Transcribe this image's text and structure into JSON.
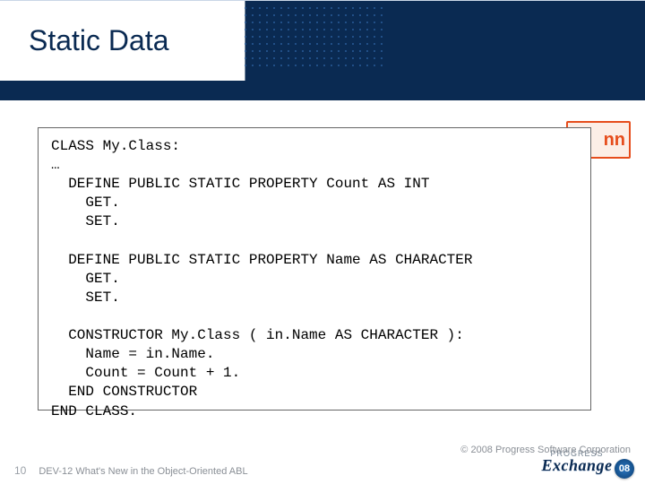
{
  "title": "Static Data",
  "peek_label": "nn",
  "code": {
    "line1": "CLASS My.Class:",
    "line2": "…",
    "line3": "  DEFINE PUBLIC STATIC PROPERTY Count AS INT",
    "line4": "    GET.",
    "line5": "    SET.",
    "line6": "",
    "line7": "  DEFINE PUBLIC STATIC PROPERTY Name AS CHARACTER",
    "line8": "    GET.",
    "line9": "    SET.",
    "line10": "",
    "line11": "  CONSTRUCTOR My.Class ( in.Name AS CHARACTER ):",
    "line12": "    Name = in.Name.",
    "line13": "    Count = Count + 1.",
    "line14": "  END CONSTRUCTOR",
    "line15": "END CLASS."
  },
  "footer": {
    "page_number": "10",
    "session_label": "DEV-12 What's New in the Object-Oriented ABL",
    "copyright": "© 2008 Progress Software Corporation",
    "logo_small": "PROGRESS",
    "logo_main": "Exchange",
    "logo_badge": "08"
  }
}
